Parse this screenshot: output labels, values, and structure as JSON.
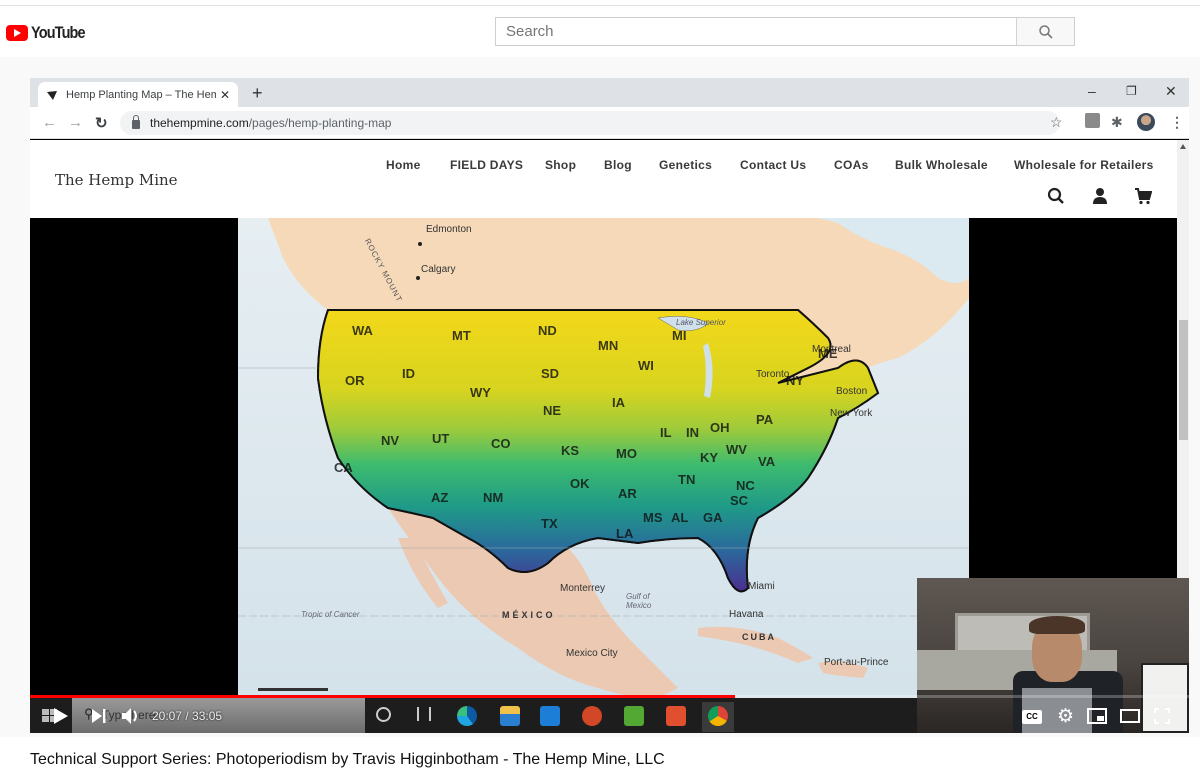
{
  "youtube": {
    "logo_text": "YouTube",
    "search_placeholder": "Search",
    "search_value": "",
    "video_title": "Technical Support Series: Photoperiodism by Travis Higginbotham - The Hemp Mine, LLC",
    "player": {
      "current_time": "20:07",
      "separator": " / ",
      "duration": "33:05",
      "progress_fraction": 0.608
    },
    "colors": {
      "brand_red": "#ff0000"
    }
  },
  "browser": {
    "tab_title": "Hemp Planting Map – The Hemp",
    "new_tab_label": "+",
    "url_host": "thehempmine.com",
    "url_path": "/pages/hemp-planting-map",
    "window_controls": {
      "minimize": "–",
      "restore": "❐",
      "close": "✕"
    }
  },
  "website": {
    "logo": "The Hemp Mine",
    "nav": [
      {
        "label": "Home"
      },
      {
        "label": "FIELD DAYS"
      },
      {
        "label": "Shop"
      },
      {
        "label": "Blog"
      },
      {
        "label": "Genetics"
      },
      {
        "label": "Contact Us"
      },
      {
        "label": "COAs"
      },
      {
        "label": "Bulk Wholesale"
      },
      {
        "label": "Wholesale for Retailers"
      }
    ],
    "icons": [
      "search-icon",
      "account-icon",
      "cart-icon"
    ]
  },
  "map": {
    "cities": [
      {
        "name": "Edmonton"
      },
      {
        "name": "Calgary"
      },
      {
        "name": "Montreal"
      },
      {
        "name": "Toronto"
      },
      {
        "name": "Boston"
      },
      {
        "name": "New York"
      },
      {
        "name": "Monterrey"
      },
      {
        "name": "Miami"
      },
      {
        "name": "Havana"
      },
      {
        "name": "Mexico City"
      },
      {
        "name": "Port-au-Prince"
      }
    ],
    "regions": [
      {
        "name": "MÉXICO"
      },
      {
        "name": "CUBA"
      },
      {
        "name": "Gulf of Mexico"
      },
      {
        "name": "Tropic of Cancer"
      },
      {
        "name": "Lake Superior"
      },
      {
        "name": "ROCKY MOUNT"
      }
    ],
    "states": [
      "WA",
      "MT",
      "ND",
      "MN",
      "OR",
      "ID",
      "SD",
      "WY",
      "WI",
      "MI",
      "NY",
      "ME",
      "IA",
      "NE",
      "NV",
      "UT",
      "CO",
      "IL",
      "IN",
      "OH",
      "PA",
      "CA",
      "KS",
      "MO",
      "KY",
      "WV",
      "VA",
      "AZ",
      "NM",
      "OK",
      "AR",
      "TN",
      "NC",
      "MS",
      "AL",
      "GA",
      "SC",
      "TX",
      "LA"
    ],
    "gradient_colors": [
      "#f3d81a",
      "#c6cf2a",
      "#7fc84a",
      "#2db27c",
      "#1f8f8c",
      "#2a5e9a",
      "#4a2f8f"
    ]
  },
  "taskbar": {
    "search_text": "Type here",
    "apps": [
      "cortana-icon",
      "task-view-icon",
      "edge-icon",
      "file-explorer-icon",
      "mail-icon",
      "powerpoint-icon",
      "camtasia-green-icon",
      "camtasia-orange-icon",
      "chrome-icon"
    ]
  }
}
